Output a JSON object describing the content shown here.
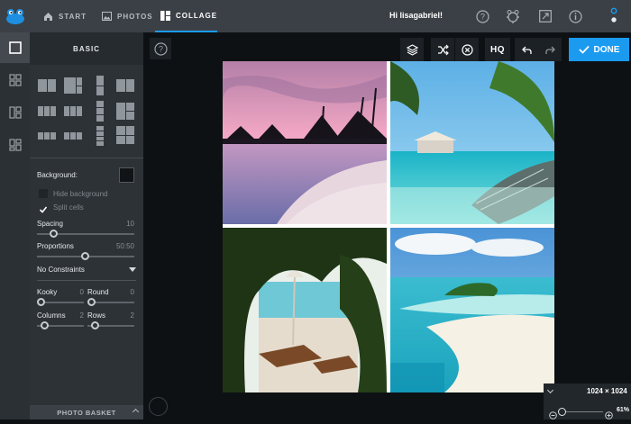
{
  "header": {
    "tabs": [
      {
        "label": "START",
        "icon": "home-icon"
      },
      {
        "label": "PHOTOS",
        "icon": "photo-icon"
      },
      {
        "label": "COLLAGE",
        "icon": "collage-icon",
        "active": true
      }
    ],
    "greeting": "Hi lisagabriel!",
    "right_icons": [
      "help-icon",
      "frog-settings-icon",
      "expand-icon",
      "info-icon",
      "more-icon"
    ],
    "accent": "#1a9bf0"
  },
  "rail": {
    "items": [
      "layout-single-icon",
      "layout-grid-icon",
      "layout-columns-icon",
      "layout-mixed-icon"
    ]
  },
  "panel": {
    "title": "BASIC",
    "background_label": "Background:",
    "background_color": "#111417",
    "hide_background_label": "Hide background",
    "split_cells_label": "Split cells",
    "split_cells_checked": true,
    "spacing_label": "Spacing",
    "spacing_value": "10",
    "proportions_label": "Proportions",
    "proportions_value": "50:50",
    "constraints_value": "No Constraints",
    "kooky_label": "Kooky",
    "kooky_value": "0",
    "round_label": "Round",
    "round_value": "0",
    "columns_label": "Columns",
    "columns_value": "2",
    "rows_label": "Rows",
    "rows_value": "2",
    "basket_label": "PHOTO BASKET"
  },
  "toolbar": {
    "hq_label": "HQ",
    "done_label": "DONE"
  },
  "canvas": {
    "size_label": "1024 × 1024",
    "zoom_label": "61%",
    "photos": [
      "sunset-beach-photo",
      "overwater-bungalow-photo",
      "beach-loungers-photo",
      "island-sandbar-photo"
    ]
  }
}
